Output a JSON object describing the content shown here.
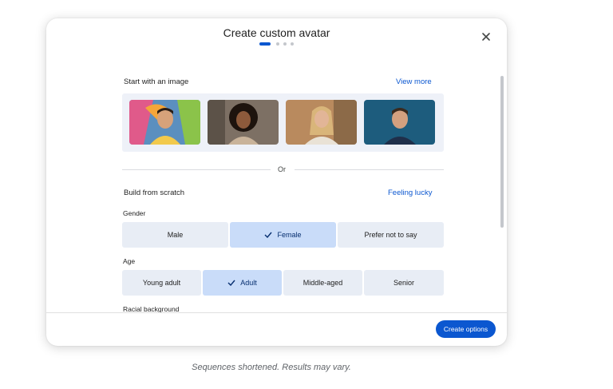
{
  "dialog": {
    "title": "Create custom avatar",
    "close_icon": "close-icon",
    "steps": {
      "current": 1,
      "total": 4
    }
  },
  "image_section": {
    "heading": "Start with an image",
    "view_more": "View more",
    "thumbnails": [
      {
        "name": "avatar-thumbnail-man-graffiti",
        "bg": "#6aa0c8",
        "skin": "#d7a27a",
        "hair": "#2a1d14",
        "shirt": "#f2c94c"
      },
      {
        "name": "avatar-thumbnail-woman-curly",
        "bg": "#8a7b6b",
        "skin": "#8d5a3b",
        "hair": "#1d130d",
        "shirt": "#c9b39a"
      },
      {
        "name": "avatar-thumbnail-woman-blonde",
        "bg": "#b98a5e",
        "skin": "#e2b597",
        "hair": "#d9b57a",
        "shirt": "#e9e2d6"
      },
      {
        "name": "avatar-thumbnail-man-dark",
        "bg": "#1d5c7d",
        "skin": "#d3a07f",
        "hair": "#3a2a1e",
        "shirt": "#1f2f4a"
      }
    ]
  },
  "divider": {
    "text": "Or"
  },
  "scratch_section": {
    "heading": "Build from scratch",
    "feeling_lucky": "Feeling lucky"
  },
  "gender": {
    "label": "Gender",
    "options": [
      "Male",
      "Female",
      "Prefer not to say"
    ],
    "selected": "Female"
  },
  "age": {
    "label": "Age",
    "options": [
      "Young adult",
      "Adult",
      "Middle-aged",
      "Senior"
    ],
    "selected": "Adult"
  },
  "racial_background": {
    "label": "Racial background"
  },
  "footer": {
    "create_button": "Create options"
  },
  "caption": "Sequences shortened. Results may vary.",
  "colors": {
    "accent": "#0b57d0",
    "selected_bg": "#c9dcf9",
    "option_bg": "#e8edf5"
  }
}
